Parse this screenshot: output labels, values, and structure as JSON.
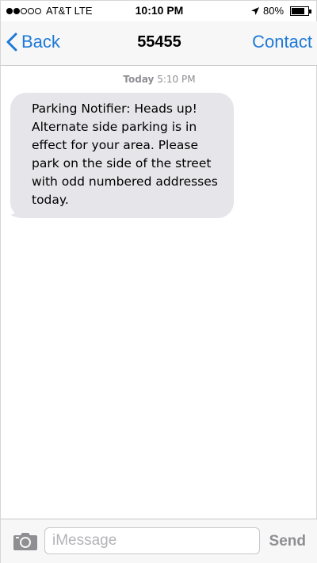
{
  "status_bar": {
    "signal_bars_filled": 2,
    "signal_bars_total": 5,
    "carrier": "AT&T LTE",
    "time": "10:10 PM",
    "location_icon": "location-arrow-icon",
    "battery_percent": "80%",
    "battery_level": 0.8
  },
  "nav": {
    "back_label": "Back",
    "back_icon": "chevron-left-icon",
    "title": "55455",
    "contact_label": "Contact",
    "accent_color": "#1d79d6"
  },
  "conversation": {
    "timestamp_day": "Today",
    "timestamp_time": "5:10 PM",
    "messages": [
      {
        "direction": "incoming",
        "text": "Parking Notifier: Heads up!\nAlternate side parking is in\neffect for your area. Please\npark on the side of the street\nwith odd numbered addresses\ntoday.",
        "bubble_color": "#e5e5ea"
      }
    ]
  },
  "composer": {
    "camera_icon": "camera-icon",
    "input_value": "",
    "input_placeholder": "iMessage",
    "send_label": "Send"
  }
}
